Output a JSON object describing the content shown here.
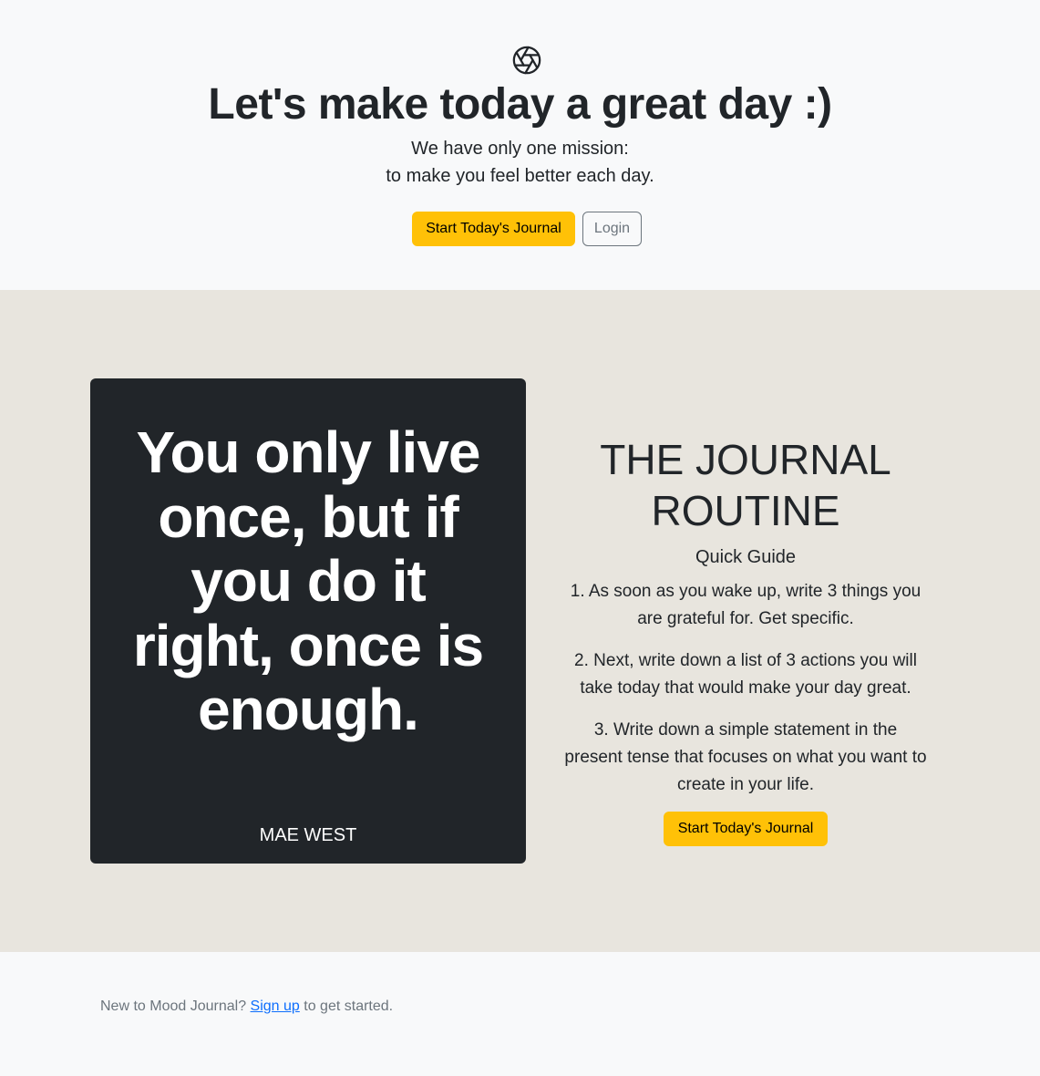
{
  "hero": {
    "icon": "aperture-icon",
    "title": "Let's make today a great day :)",
    "subtitle_line1": "We have only one mission:",
    "subtitle_line2": "to make you feel better each day.",
    "start_button": "Start Today's Journal",
    "login_button": "Login"
  },
  "quote": {
    "text": "You only live once, but if you do it right, once is enough.",
    "author": "MAE WEST"
  },
  "routine": {
    "title": "THE JOURNAL ROUTINE",
    "guide": "Quick Guide",
    "steps": [
      "1. As soon as you wake up, write 3 things you are grateful for. Get specific.",
      "2. Next, write down a list of 3 actions you will take today that would make your day great.",
      "3. Write down a simple statement in the present tense that focuses on what you want to create in your life."
    ],
    "start_button": "Start Today's Journal"
  },
  "footer": {
    "prefix": "New to Mood Journal?",
    "link": "Sign up",
    "suffix": "to get started."
  },
  "colors": {
    "accent": "#ffc107",
    "dark": "#212529",
    "middle_bg": "#e8e5de",
    "light_bg": "#f8f9fa",
    "link": "#0d6efd"
  }
}
